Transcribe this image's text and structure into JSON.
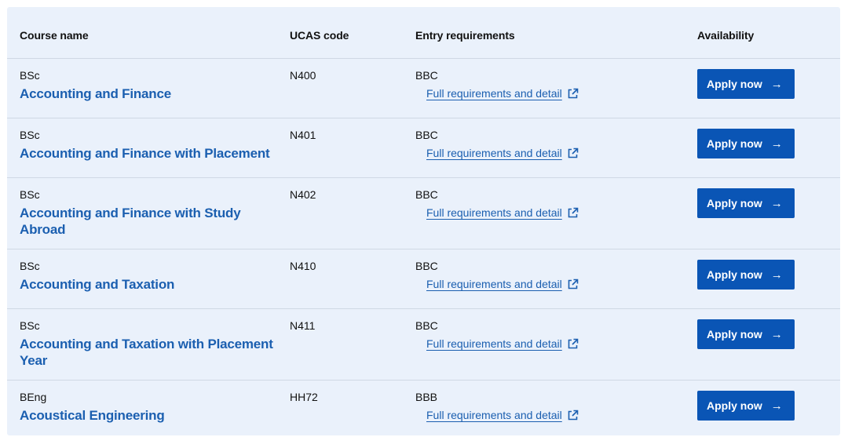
{
  "table": {
    "headers": {
      "course": "Course name",
      "ucas": "UCAS code",
      "entry": "Entry requirements",
      "availability": "Availability"
    },
    "rows": [
      {
        "degree": "BSc",
        "course": "Accounting and Finance",
        "ucas": "N400",
        "grade": "BBC",
        "link": "Full requirements and detail",
        "apply": "Apply now"
      },
      {
        "degree": "BSc",
        "course": "Accounting and Finance with Placement",
        "ucas": "N401",
        "grade": "BBC",
        "link": "Full requirements and detail",
        "apply": "Apply now"
      },
      {
        "degree": "BSc",
        "course": "Accounting and Finance with Study Abroad",
        "ucas": "N402",
        "grade": "BBC",
        "link": "Full requirements and detail",
        "apply": "Apply now"
      },
      {
        "degree": "BSc",
        "course": "Accounting and Taxation",
        "ucas": "N410",
        "grade": "BBC",
        "link": "Full requirements and detail",
        "apply": "Apply now"
      },
      {
        "degree": "BSc",
        "course": "Accounting and Taxation with Placement Year",
        "ucas": "N411",
        "grade": "BBC",
        "link": "Full requirements and detail",
        "apply": "Apply now"
      },
      {
        "degree": "BEng",
        "course": "Acoustical Engineering",
        "ucas": "HH72",
        "grade": "BBB",
        "link": "Full requirements and detail",
        "apply": "Apply now"
      }
    ]
  },
  "icons": {
    "external_link": "external-link-icon",
    "apply_arrow": "arrow-right-icon"
  },
  "colors": {
    "panel_bg": "#eaf1fb",
    "link": "#1b5fb0",
    "button_bg": "#0a55b5",
    "divider": "#cfd8e4"
  }
}
